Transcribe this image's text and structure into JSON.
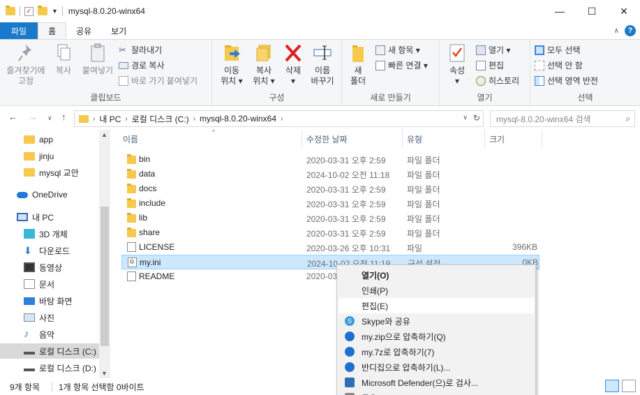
{
  "window": {
    "title": "mysql-8.0.20-winx64",
    "minimize": "—",
    "maximize": "☐",
    "close": "✕"
  },
  "ribbon_tabs": [
    "파일",
    "홈",
    "공유",
    "보기"
  ],
  "ribbon": {
    "clipboard": {
      "label": "클립보드",
      "pin": [
        "즐겨찾기에",
        "고정"
      ],
      "copy": "복사",
      "paste": "붙여넣기",
      "cut": "잘라내기",
      "copy_path": "경로 복사",
      "paste_shortcut": "바로 가기 붙여넣기"
    },
    "organize": {
      "label": "구성",
      "move": [
        "이동",
        "위치 ▾"
      ],
      "copyto": [
        "복사",
        "위치 ▾"
      ],
      "delete": [
        "삭제",
        "▾"
      ],
      "rename": [
        "이름",
        "바꾸기"
      ]
    },
    "new": {
      "label": "새로 만들기",
      "new_folder": [
        "새",
        "폴더"
      ],
      "new_item": "새 항목 ▾",
      "easy_access": "빠른 연결 ▾"
    },
    "open": {
      "label": "열기",
      "properties": [
        "속성",
        "▾"
      ],
      "open": "열기 ▾",
      "edit": "편집",
      "history": "히스토리"
    },
    "select": {
      "label": "선택",
      "select_all": "모두 선택",
      "select_none": "선택 안 함",
      "invert": "선택 영역 반전"
    }
  },
  "address": {
    "crumbs": [
      "내 PC",
      "로컬 디스크 (C:)",
      "mysql-8.0.20-winx64"
    ],
    "search_placeholder": "mysql-8.0.20-winx64 검색"
  },
  "nav": [
    {
      "label": "app",
      "icon": "folder-icon"
    },
    {
      "label": "jinju",
      "icon": "folder-icon"
    },
    {
      "label": "mysql 교안",
      "icon": "folder-icon"
    },
    {
      "label": "OneDrive",
      "icon": "cloud-icon"
    },
    {
      "label": "내 PC",
      "icon": "pc-icon"
    },
    {
      "label": "3D 개체",
      "icon": "cube-icon"
    },
    {
      "label": "다운로드",
      "icon": "download-icon"
    },
    {
      "label": "동영상",
      "icon": "video-icon"
    },
    {
      "label": "문서",
      "icon": "document-icon"
    },
    {
      "label": "바탕 화면",
      "icon": "desktop-icon"
    },
    {
      "label": "사진",
      "icon": "picture-icon"
    },
    {
      "label": "음악",
      "icon": "music-icon"
    },
    {
      "label": "로컬 디스크 (C:)",
      "icon": "drive-icon"
    },
    {
      "label": "로컬 디스크 (D:)",
      "icon": "drive-icon"
    }
  ],
  "columns": [
    "이름",
    "수정한 날짜",
    "유형",
    "크기"
  ],
  "files": [
    {
      "name": "bin",
      "date": "2020-03-31 오후 2:59",
      "type": "파일 폴더",
      "size": "",
      "icon": "folder-icon"
    },
    {
      "name": "data",
      "date": "2024-10-02 오전 11:18",
      "type": "파일 폴더",
      "size": "",
      "icon": "folder-icon"
    },
    {
      "name": "docs",
      "date": "2020-03-31 오후 2:59",
      "type": "파일 폴더",
      "size": "",
      "icon": "folder-icon"
    },
    {
      "name": "include",
      "date": "2020-03-31 오후 2:59",
      "type": "파일 폴더",
      "size": "",
      "icon": "folder-icon"
    },
    {
      "name": "lib",
      "date": "2020-03-31 오후 2:59",
      "type": "파일 폴더",
      "size": "",
      "icon": "folder-icon"
    },
    {
      "name": "share",
      "date": "2020-03-31 오후 2:59",
      "type": "파일 폴더",
      "size": "",
      "icon": "folder-icon"
    },
    {
      "name": "LICENSE",
      "date": "2020-03-26 오후 10:31",
      "type": "파일",
      "size": "396KB",
      "icon": "file-icon"
    },
    {
      "name": "my.ini",
      "date": "2024-10-02 오전 11:19",
      "type": "구성 설정",
      "size": "0KB",
      "icon": "settings-file-icon"
    },
    {
      "name": "README",
      "date": "2020-03",
      "type": "",
      "size": "",
      "icon": "file-icon"
    }
  ],
  "context_menu": [
    {
      "label": "열기(O)",
      "bold": true,
      "icon": ""
    },
    {
      "label": "인쇄(P)",
      "icon": ""
    },
    {
      "label": "편집(E)",
      "icon": ""
    },
    {
      "label": "Skype와 공유",
      "icon": "skype-icon"
    },
    {
      "label": "my.zip으로 압축하기(Q)",
      "icon": "bandizip-icon"
    },
    {
      "label": "my.7z로 압축하기(7)",
      "icon": "bandizip-icon"
    },
    {
      "label": "반디집으로 압축하기(L)...",
      "icon": "bandizip-icon"
    },
    {
      "label": "Microsoft Defender(으)로 검사...",
      "icon": "defender-icon"
    },
    {
      "label": "공유",
      "icon": "share-icon"
    }
  ],
  "status": {
    "count": "9개 항목",
    "selection": "1개 항목 선택함 0바이트"
  },
  "colors": {
    "accent": "#1979ca",
    "selection": "#cce8ff",
    "folder": "#f6c94c"
  }
}
